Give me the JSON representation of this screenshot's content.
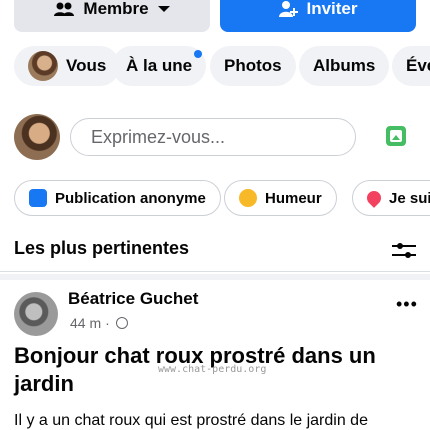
{
  "actions": {
    "member_label": "Membre",
    "invite_label": "Inviter"
  },
  "tabs": [
    {
      "label": "Vous"
    },
    {
      "label": "À la une"
    },
    {
      "label": "Photos"
    },
    {
      "label": "Albums"
    },
    {
      "label": "Évé"
    }
  ],
  "composer": {
    "placeholder": "Exprimez-vous..."
  },
  "chips": [
    {
      "label": "Publication anonyme"
    },
    {
      "label": "Humeur"
    },
    {
      "label": "Je suis"
    }
  ],
  "feed": {
    "section_title": "Les plus pertinentes"
  },
  "post": {
    "author": "Béatrice Guchet",
    "time": "44 m",
    "title": "Bonjour chat roux prostré dans un jardin",
    "watermark": "www.chat-perdu.org",
    "body": "Il y a un chat roux qui est prostré dans le jardin de"
  },
  "colors": {
    "primary": "#1877f2",
    "chip_bg": "#f0f2f5",
    "text": "#050505",
    "muted": "#65676b"
  },
  "icons": [
    "members-icon",
    "chevron-down-icon",
    "add-person-icon",
    "photo-icon",
    "anon-icon",
    "mood-icon",
    "pin-icon",
    "sliders-icon",
    "globe-icon",
    "more-icon"
  ]
}
